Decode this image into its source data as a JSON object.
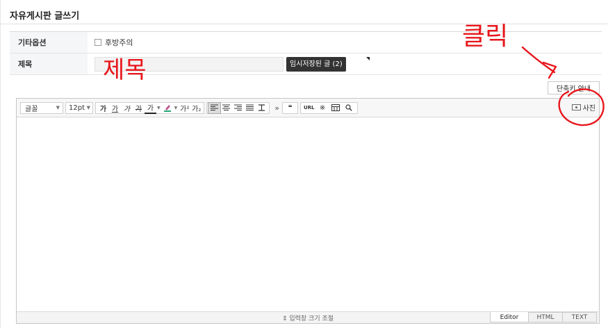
{
  "page": {
    "title": "자유게시판 글쓰기"
  },
  "form": {
    "options_label": "기타옵션",
    "checkbox_label": "후방주의",
    "subject_label": "제목",
    "subject_value": "",
    "temp_saved_label": "임시저장된 글 (2)"
  },
  "shortcut_button": "단축키 안내",
  "toolbar": {
    "font_select": "글꼴",
    "size_select": "12pt",
    "bold": "가",
    "underline": "가",
    "italic": "가",
    "strike": "가",
    "font_color": "가",
    "bg_color": "가",
    "superscript": "가²",
    "subscript": "가₂",
    "more": "»",
    "quote": "❝",
    "link": "URL",
    "special_char": "※",
    "photo_label": "사진"
  },
  "editor": {
    "resize_label": "⇕ 입력창 크기 조절",
    "tabs": [
      "Editor",
      "HTML",
      "TEXT"
    ]
  },
  "annotations": {
    "click_note": "클릭",
    "subject_note": "제목",
    "ink_color": "#e8161b"
  }
}
